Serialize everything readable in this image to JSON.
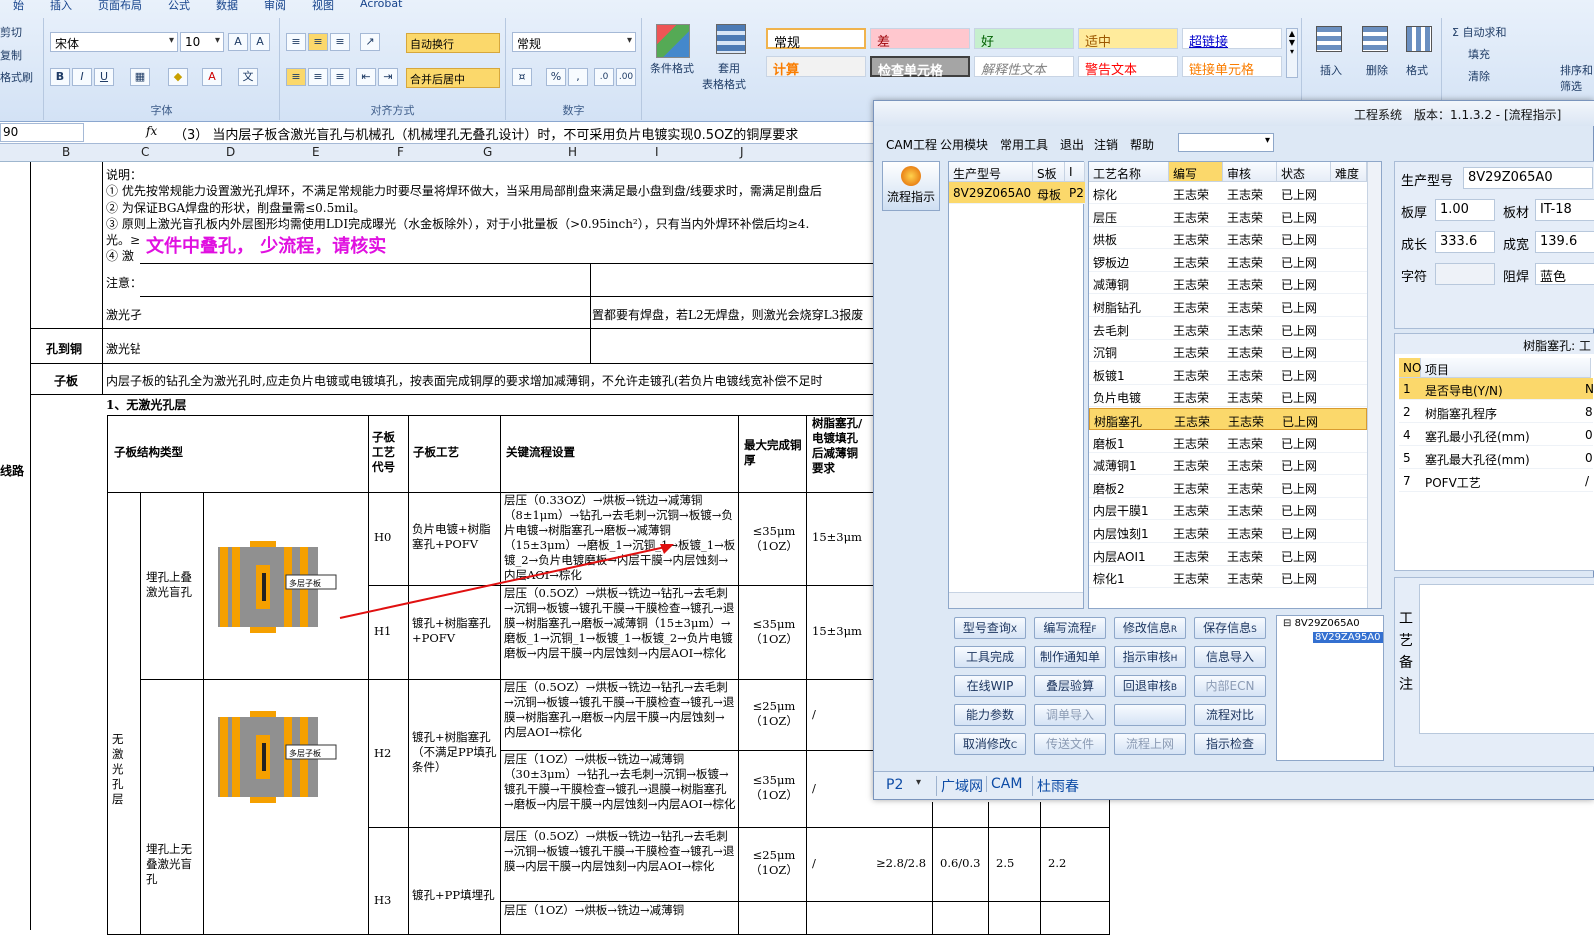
{
  "ribbon": {
    "tabs": [
      "始",
      "插入",
      "页面布局",
      "公式",
      "数据",
      "审阅",
      "视图",
      "Acrobat"
    ],
    "clip": {
      "cut": "剪切",
      "copy": "复制",
      "painter": "格式刷"
    },
    "font": {
      "name": "宋体",
      "size": "10",
      "label": "字体"
    },
    "align": {
      "wrap": "自动换行",
      "merge": "合并后居中",
      "label": "对齐方式"
    },
    "number": {
      "format": "常规",
      "label": "数字",
      "pct": "%"
    },
    "styles": {
      "cond": "条件格式",
      "table1": "套用",
      "table2": "表格格式",
      "cells": [
        "常规",
        "差",
        "好",
        "适中",
        "超链接",
        "计算",
        "检查单元格",
        "解释性文本",
        "警告文本",
        "链接单元格"
      ]
    },
    "cells": {
      "insert": "插入",
      "delete": "删除",
      "format": "格式"
    },
    "edit": {
      "autosum": "Σ 自动求和",
      "fill": "填充",
      "clear": "清除",
      "sort1": "排序和",
      "sort2": "筛选"
    }
  },
  "formula": {
    "ref": "90",
    "fx": "fx",
    "text": "（3） 当内层子板含激光盲孔与机械孔（机械埋孔无叠孔设计）时，不可采用负片电镀实现0.5OZ的铜厚要求"
  },
  "columns": [
    "B",
    "C",
    "D",
    "E",
    "F",
    "G",
    "H",
    "I",
    "J"
  ],
  "sheet": {
    "notes": [
      "说明：",
      "① 优先按常规能力设置激光孔焊环，不满足常规能力时要尽量将焊环做大，当采用局部削盘来满足最小盘到盘/线要求时，需满足削盘后",
      "② 为保证BGA焊盘的形状，削盘量需≤0.5mil。",
      "③ 原则上激光盲孔板内外层图形均需使用LDI完成曝光（水金板除外），对于小批量板（>0.95inch²），只有当内外焊环补偿后均≥4.",
      "光。≥",
      "④ 激"
    ],
    "annotation": "文件中叠孔， 少流程，请核实",
    "note_label": "注意：",
    "laser_a": "激光孑",
    "laser_b": "激光钻",
    "laser_right": "置都要有焊盘，若L2无焊盘，则激光会烧穿L3报废",
    "row_labels": {
      "hole_copper": "孔到铜",
      "sub": "子板",
      "route": "线路"
    },
    "sub_text": "内层子板的钻孔全为激光孔时,应走负片电镀或电镀填孔，按表面完成铜厚的要求增加减薄铜，不允许走镀孔(若负片电镀线宽补偿不足时",
    "section": "1、无激光孔层",
    "headers": {
      "type": "子板结构类型",
      "code": "子板工艺代号",
      "process": "子板工艺",
      "flow": "关键流程设置",
      "max": "最大完成铜厚",
      "resin": "树脂塞孔/电镀填孔后减薄铜要求"
    },
    "groups": {
      "g1": "埋孔上叠激光盲孔",
      "g2": "埋孔上无叠激光盲孔",
      "side": "无激光孔层",
      "pcb_label": "多层子板"
    },
    "rows": [
      {
        "code": "H0",
        "process": "负片电镀+树脂塞孔+POFV",
        "flow": "层压（0.33OZ）→烘板→铣边→减薄铜（8±1μm）→钻孔→去毛刺→沉铜→板镀→负片电镀→树脂塞孔→磨板→减薄铜（15±3μm）→磨板_1→沉铜_1→板镀_1→板镀_2→负片电镀磨板→内层干膜→内层蚀刻→内层AOI→棕化",
        "max": "≤35μm（1OZ）",
        "resin": "15±3μm"
      },
      {
        "code": "H1",
        "process": "镀孔+树脂塞孔+POFV",
        "flow": "层压（0.5OZ）→烘板→铣边→钻孔→去毛刺→沉铜→板镀→镀孔干膜→干膜检查→镀孔→退膜→树脂塞孔→磨板→减薄铜（15±3μm）→磨板_1→沉铜_1→板镀_1→板镀_2→负片电镀磨板→内层干膜→内层蚀刻→内层AOI→棕化",
        "max": "≤35μm（1OZ）",
        "resin": "15±3μm"
      },
      {
        "code": "H2",
        "process": "镀孔+树脂塞孔（不满足PP填孔条件）",
        "flow": "层压（0.5OZ）→烘板→铣边→钻孔→去毛刺→沉铜→板镀→镀孔干膜→干膜检查→镀孔→退膜→树脂塞孔→磨板→内层干膜→内层蚀刻→内层AOI→棕化",
        "max": "≤25μm（1OZ）",
        "resin": "/"
      },
      {
        "code": "",
        "process": "",
        "flow": "层压（1OZ）→烘板→铣边→减薄铜（30±3μm）→钻孔→去毛刺→沉铜→板镀→镀孔干膜→干膜检查→镀孔→退膜→树脂塞孔→磨板→内层干膜→内层蚀刻→内层AOI→棕化",
        "max": "≤35μm（1OZ）",
        "resin": "/"
      },
      {
        "code": "H3",
        "process": "镀孔+PP填埋孔",
        "flow": "层压（0.5OZ）→烘板→铣边→钻孔→去毛刺→沉铜→板镀→镀孔干膜→干膜检查→镀孔→退膜→内层干膜→内层蚀刻→内层AOI→棕化",
        "max": "≤25μm（1OZ）",
        "resin": "/",
        "extra": [
          "≥2.8/2.8",
          "0.6/0.3",
          "2.5",
          "2.2"
        ]
      },
      {
        "code": "",
        "process": "",
        "flow": "层压（1OZ）→烘板→铣边→减薄铜",
        "max": "",
        "resin": ""
      }
    ]
  },
  "window": {
    "title": "工程系统　版本：1.1.3.2 - [流程指示]",
    "menu": [
      "CAM工程",
      "公用模块",
      "常用工具",
      "退出",
      "注销",
      "帮助"
    ],
    "side_button": "流程指示",
    "left_grid": {
      "headers": [
        "生产型号",
        "S板",
        "I"
      ],
      "row": [
        "8V29Z065A0",
        "母板",
        "P2"
      ]
    },
    "proc_grid": {
      "headers": [
        "工艺名称",
        "编写",
        "审核",
        "状态",
        "难度"
      ],
      "rows": [
        [
          "棕化",
          "王志荣",
          "王志荣",
          "已上网"
        ],
        [
          "层压",
          "王志荣",
          "王志荣",
          "已上网"
        ],
        [
          "烘板",
          "王志荣",
          "王志荣",
          "已上网"
        ],
        [
          "锣板边",
          "王志荣",
          "王志荣",
          "已上网"
        ],
        [
          "减薄铜",
          "王志荣",
          "王志荣",
          "已上网"
        ],
        [
          "树脂钻孔",
          "王志荣",
          "王志荣",
          "已上网"
        ],
        [
          "去毛刺",
          "王志荣",
          "王志荣",
          "已上网"
        ],
        [
          "沉铜",
          "王志荣",
          "王志荣",
          "已上网"
        ],
        [
          "板镀1",
          "王志荣",
          "王志荣",
          "已上网"
        ],
        [
          "负片电镀",
          "王志荣",
          "王志荣",
          "已上网"
        ],
        [
          "树脂塞孔",
          "王志荣",
          "王志荣",
          "已上网"
        ],
        [
          "磨板1",
          "王志荣",
          "王志荣",
          "已上网"
        ],
        [
          "减薄铜1",
          "王志荣",
          "王志荣",
          "已上网"
        ],
        [
          "磨板2",
          "王志荣",
          "王志荣",
          "已上网"
        ],
        [
          "内层干膜1",
          "王志荣",
          "王志荣",
          "已上网"
        ],
        [
          "内层蚀刻1",
          "王志荣",
          "王志荣",
          "已上网"
        ],
        [
          "内层AOI1",
          "王志荣",
          "王志荣",
          "已上网"
        ],
        [
          "棕化1",
          "王志荣",
          "王志荣",
          "已上网"
        ]
      ],
      "selected": 10
    },
    "buttons": [
      [
        "型号查询",
        "编写流程",
        "修改信息",
        "保存信息"
      ],
      [
        "工具完成",
        "制作通知单",
        "指示审核",
        "信息导入"
      ],
      [
        "在线WIP",
        "叠层验算",
        "回退审核",
        "内部ECN"
      ],
      [
        "能力参数",
        "调单导入",
        "",
        "流程对比"
      ],
      [
        "取消修改",
        "传送文件",
        "流程上网",
        "指示检查"
      ]
    ],
    "btn_keys": [
      [
        "X",
        "F",
        "R",
        "S"
      ],
      [
        "",
        "",
        "H",
        ""
      ],
      [
        "",
        "",
        "B",
        ""
      ],
      [
        "",
        "",
        "",
        ""
      ],
      [
        "C",
        "",
        "",
        ""
      ]
    ],
    "tree": {
      "root": "8V29Z065A0",
      "child": "8V29ZA95A0"
    },
    "info": {
      "model_label": "生产型号",
      "model": "8V29Z065A0",
      "thick_label": "板厚",
      "thick": "1.00",
      "mat_label": "板材",
      "mat": "IT-18",
      "len_label": "成长",
      "len": "333.6",
      "wid_label": "成宽",
      "wid": "139.6",
      "char_label": "字符",
      "char": "",
      "mask_label": "阻焊",
      "mask": "蓝色"
    },
    "resin_panel": {
      "title": "树脂塞孔: 工",
      "headers": [
        "NO",
        "项目"
      ],
      "rows": [
        [
          "1",
          "是否导电(Y/N)",
          "N"
        ],
        [
          "2",
          "树脂塞孔程序",
          "8"
        ],
        [
          "4",
          "塞孔最小孔径(mm)",
          "0"
        ],
        [
          "5",
          "塞孔最大孔径(mm)",
          "0"
        ],
        [
          "7",
          "POFV工艺",
          "/"
        ]
      ]
    },
    "remark_label": "工艺备注",
    "status": {
      "p": "P2",
      "tabs": [
        "广域网",
        "CAM",
        "杜雨春"
      ]
    }
  }
}
